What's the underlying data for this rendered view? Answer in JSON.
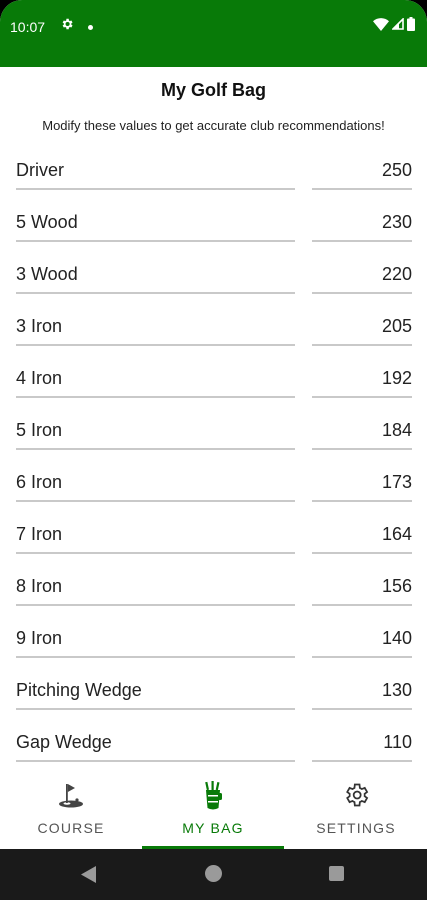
{
  "status_bar": {
    "time": "10:07"
  },
  "header": {
    "title": "My Golf Bag",
    "subtitle": "Modify these values to get accurate club recommendations!"
  },
  "clubs": [
    {
      "name": "Driver",
      "distance": "250"
    },
    {
      "name": "5 Wood",
      "distance": "230"
    },
    {
      "name": "3 Wood",
      "distance": "220"
    },
    {
      "name": "3 Iron",
      "distance": "205"
    },
    {
      "name": "4 Iron",
      "distance": "192"
    },
    {
      "name": "5 Iron",
      "distance": "184"
    },
    {
      "name": "6 Iron",
      "distance": "173"
    },
    {
      "name": "7 Iron",
      "distance": "164"
    },
    {
      "name": "8 Iron",
      "distance": "156"
    },
    {
      "name": "9 Iron",
      "distance": "140"
    },
    {
      "name": "Pitching Wedge",
      "distance": "130"
    },
    {
      "name": "Gap Wedge",
      "distance": "110"
    }
  ],
  "bottom_nav": {
    "items": [
      {
        "label": "COURSE",
        "icon": "golf-flag-icon",
        "active": false
      },
      {
        "label": "MY BAG",
        "icon": "golf-bag-icon",
        "active": true
      },
      {
        "label": "SETTINGS",
        "icon": "gear-icon",
        "active": false
      }
    ]
  },
  "colors": {
    "primary": "#087a08",
    "underline": "#c9c9c9"
  }
}
